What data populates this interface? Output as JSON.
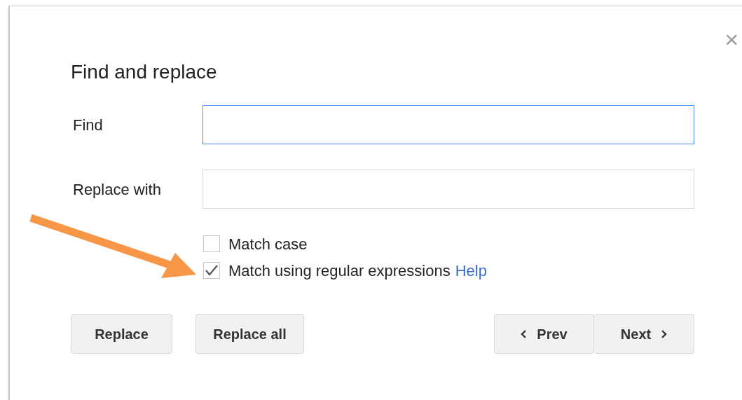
{
  "dialog": {
    "title": "Find and replace",
    "close": "×"
  },
  "fields": [
    {
      "label": "Find",
      "focused": true
    },
    {
      "label": "Replace with",
      "focused": false
    }
  ],
  "options": [
    {
      "label": "Match case",
      "checked": false
    },
    {
      "label": "Match using regular expressions",
      "checked": true,
      "link": "Help"
    }
  ],
  "buttons": [
    {
      "label": "Replace"
    },
    {
      "label": "Replace all"
    }
  ],
  "nav": [
    {
      "label": "Prev",
      "kind": "prev"
    },
    {
      "label": "Next",
      "kind": "next"
    }
  ],
  "annotation": {
    "kind": "arrow",
    "color": "#f79646"
  }
}
